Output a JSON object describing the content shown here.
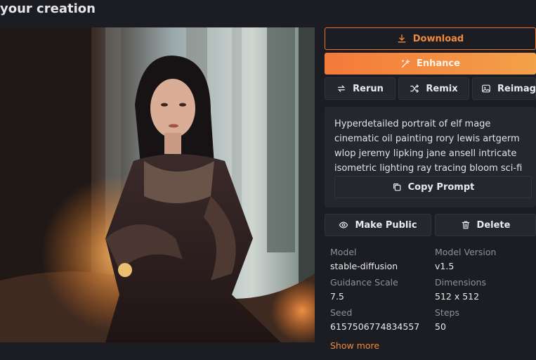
{
  "header": {
    "title": "your creation"
  },
  "actions": {
    "download_label": "Download",
    "enhance_label": "Enhance",
    "rerun_label": "Rerun",
    "remix_label": "Remix",
    "reimage_label": "Reimage"
  },
  "prompt": {
    "text": "Hyperdetailed portrait of elf mage cinematic oil painting rory lewis artgerm wlop jeremy lipking jane ansell intricate isometric lighting ray tracing bloom sci-fi fantasy",
    "copy_label": "Copy Prompt"
  },
  "visibility": {
    "make_public_label": "Make Public",
    "delete_label": "Delete"
  },
  "details": [
    {
      "label": "Model",
      "value": "stable-diffusion"
    },
    {
      "label": "Model Version",
      "value": "v1.5"
    },
    {
      "label": "Guidance Scale",
      "value": "7.5"
    },
    {
      "label": "Dimensions",
      "value": "512 x 512"
    },
    {
      "label": "Seed",
      "value": "6157506774834557"
    },
    {
      "label": "Steps",
      "value": "50"
    }
  ],
  "show_more_label": "Show more",
  "colors": {
    "accent": "#f08a3c",
    "background": "#1b1d22",
    "card": "#24272d"
  },
  "icons": [
    "download-icon",
    "magic-wand-icon",
    "rerun-icon",
    "shuffle-icon",
    "image-icon",
    "copy-icon",
    "eye-icon",
    "trash-icon"
  ]
}
